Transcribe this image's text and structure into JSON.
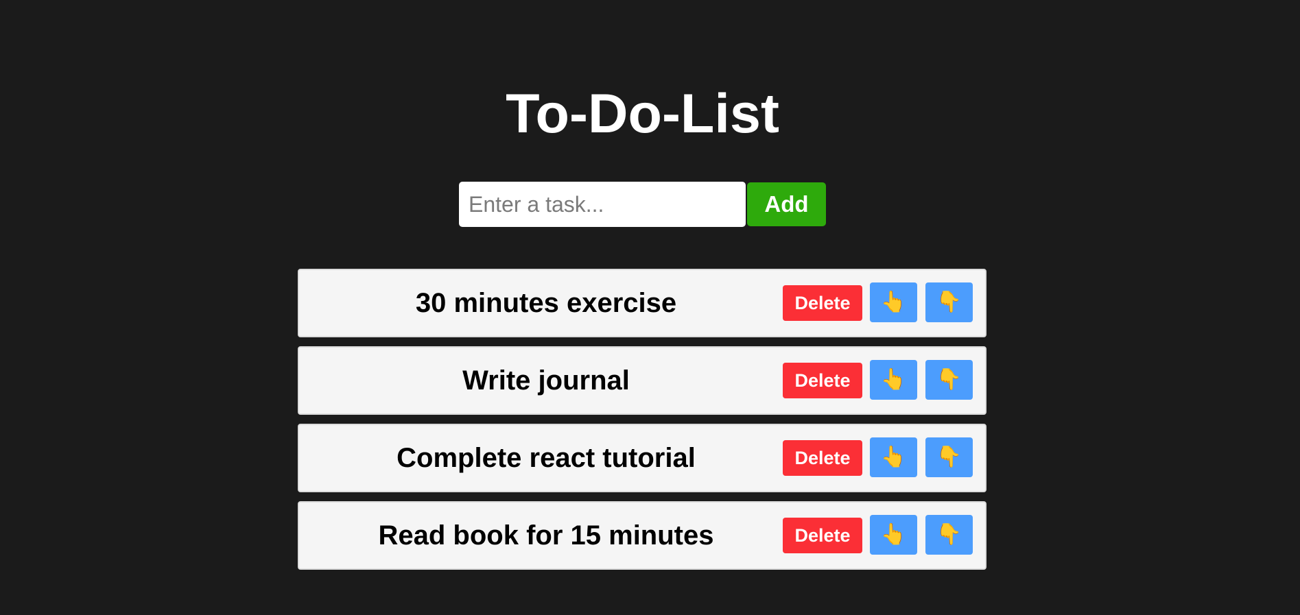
{
  "header": {
    "title": "To-Do-List"
  },
  "form": {
    "placeholder": "Enter a task...",
    "value": "",
    "add_label": "Add"
  },
  "tasks": [
    {
      "text": "30 minutes exercise",
      "delete_label": "Delete",
      "up_icon": "👆",
      "down_icon": "👇"
    },
    {
      "text": "Write journal",
      "delete_label": "Delete",
      "up_icon": "👆",
      "down_icon": "👇"
    },
    {
      "text": "Complete react tutorial",
      "delete_label": "Delete",
      "up_icon": "👆",
      "down_icon": "👇"
    },
    {
      "text": "Read book for 15 minutes",
      "delete_label": "Delete",
      "up_icon": "👆",
      "down_icon": "👇"
    }
  ],
  "colors": {
    "background": "#1b1b1b",
    "add_button": "#2eaa0c",
    "delete_button": "#fb2f36",
    "move_button": "#4c9dfd",
    "task_card": "#f5f5f5"
  },
  "icons": {
    "move_up": "pointing-up-hand-icon",
    "move_down": "pointing-down-hand-icon"
  }
}
